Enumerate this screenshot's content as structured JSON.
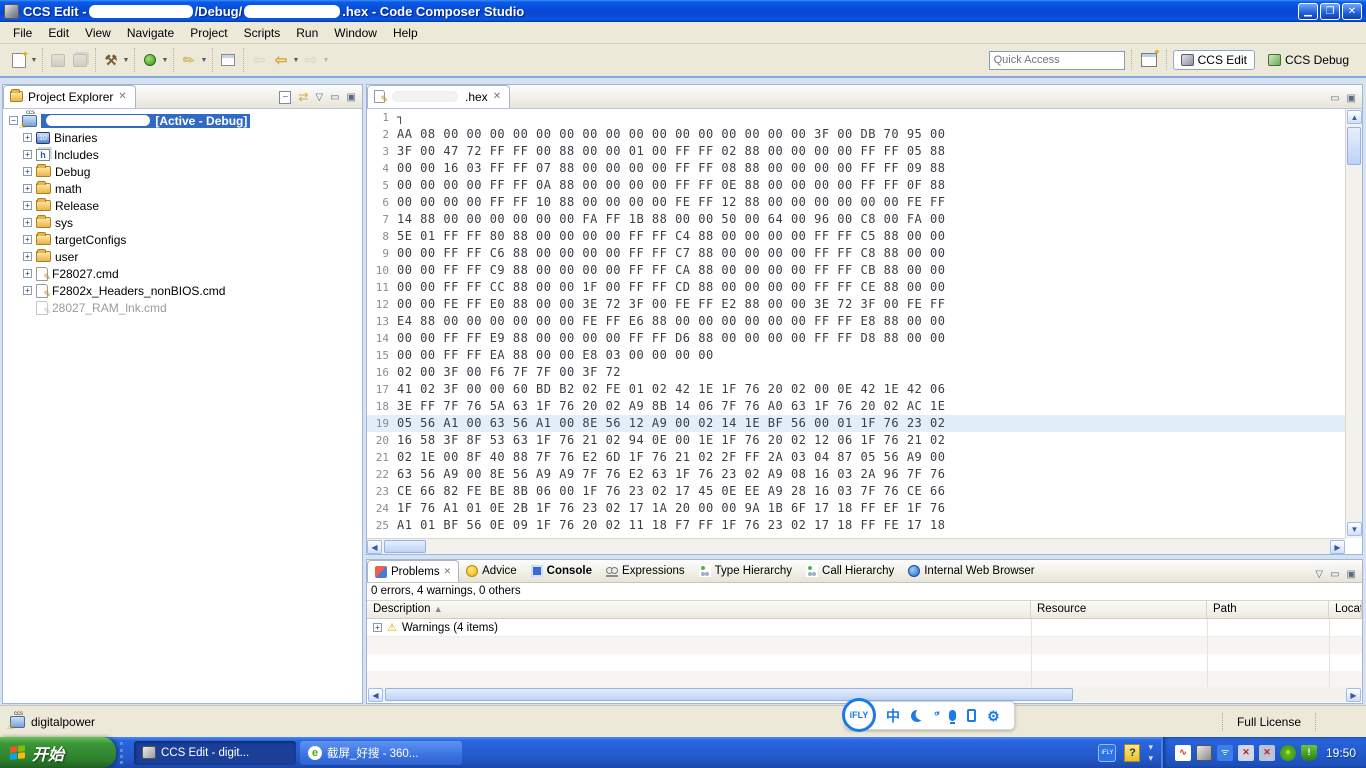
{
  "window": {
    "title_prefix": "CCS Edit - ",
    "title_mid": "/Debug/",
    "title_suffix": ".hex - Code Composer Studio"
  },
  "menu": {
    "items": [
      "File",
      "Edit",
      "View",
      "Navigate",
      "Project",
      "Scripts",
      "Run",
      "Window",
      "Help"
    ]
  },
  "toolbar": {
    "quick_access_placeholder": "Quick Access",
    "perspectives": {
      "edit": "CCS Edit",
      "debug": "CCS Debug"
    }
  },
  "project_explorer": {
    "title": "Project Explorer",
    "root_suffix": "[Active - Debug]",
    "items": [
      "Binaries",
      "Includes",
      "Debug",
      "math",
      "Release",
      "sys",
      "targetConfigs",
      "user",
      "F28027.cmd",
      "F2802x_Headers_nonBIOS.cmd",
      "28027_RAM_lnk.cmd"
    ]
  },
  "editor": {
    "tab_suffix": ".hex",
    "highlight_line": 19,
    "lines": [
      "┐",
      "AA 08 00 00 00 00 00 00 00 00 00 00 00 00 00 00 00 00 3F 00 DB 70 95 00",
      "3F 00 47 72 FF FF 00 88 00 00 01 00 FF FF 02 88 00 00 00 00 FF FF 05 88",
      "00 00 16 03 FF FF 07 88 00 00 00 00 FF FF 08 88 00 00 00 00 FF FF 09 88",
      "00 00 00 00 FF FF 0A 88 00 00 00 00 FF FF 0E 88 00 00 00 00 FF FF 0F 88",
      "00 00 00 00 FF FF 10 88 00 00 00 00 FE FF 12 88 00 00 00 00 00 00 FE FF",
      "14 88 00 00 00 00 00 00 FA FF 1B 88 00 00 50 00 64 00 96 00 C8 00 FA 00",
      "5E 01 FF FF 80 88 00 00 00 00 FF FF C4 88 00 00 00 00 FF FF C5 88 00 00",
      "00 00 FF FF C6 88 00 00 00 00 FF FF C7 88 00 00 00 00 FF FF C8 88 00 00",
      "00 00 FF FF C9 88 00 00 00 00 FF FF CA 88 00 00 00 00 FF FF CB 88 00 00",
      "00 00 FF FF CC 88 00 00 1F 00 FF FF CD 88 00 00 00 00 FF FF CE 88 00 00",
      "00 00 FE FF E0 88 00 00 3E 72 3F 00 FE FF E2 88 00 00 3E 72 3F 00 FE FF",
      "E4 88 00 00 00 00 00 00 FE FF E6 88 00 00 00 00 00 00 FF FF E8 88 00 00",
      "00 00 FF FF E9 88 00 00 00 00 FF FF D6 88 00 00 00 00 FF FF D8 88 00 00",
      "00 00 FF FF EA 88 00 00 E8 03 00 00 00 00",
      "02 00 3F 00 F6 7F 7F 00 3F 72",
      "41 02 3F 00 00 60 BD B2 02 FE 01 02 42 1E 1F 76 20 02 00 0E 42 1E 42 06",
      "3E FF 7F 76 5A 63 1F 76 20 02 A9 8B 14 06 7F 76 A0 63 1F 76 20 02 AC 1E",
      "05 56 A1 00 63 56 A1 00 8E 56 12 A9 00 02 14 1E BF 56 00 01 1F 76 23 02",
      "16 58 3F 8F 53 63 1F 76 21 02 94 0E 00 1E 1F 76 20 02 12 06 1F 76 21 02",
      "02 1E 00 8F 40 88 7F 76 E2 6D 1F 76 21 02 2F FF 2A 03 04 87 05 56 A9 00",
      "63 56 A9 00 8E 56 A9 A9 7F 76 E2 63 1F 76 23 02 A9 08 16 03 2A 96 7F 76",
      "CE 66 82 FE BE 8B 06 00 1F 76 23 02 17 45 0E EE A9 28 16 03 7F 76 CE 66",
      "1F 76 A1 01 0E 2B 1F 76 23 02 17 1A 20 00 00 9A 1B 6F 17 18 FF EF 1F 76",
      "A1 01 BF 56 0E 09 1F 76 20 02 11 18 F7 FF 1F 76 23 02 17 18 FF FE 17 18"
    ]
  },
  "problems": {
    "tabs": [
      "Problems",
      "Advice",
      "Console",
      "Expressions",
      "Type Hierarchy",
      "Call Hierarchy",
      "Internal Web Browser"
    ],
    "summary": "0 errors, 4 warnings, 0 others",
    "columns": [
      "Description",
      "Resource",
      "Path",
      "Location"
    ],
    "rows": [
      "Warnings (4 items)"
    ]
  },
  "status_bar": {
    "project": "digitalpower",
    "license": "Full License"
  },
  "ime": {
    "logo": "iFLY",
    "chinese_mode": "中"
  },
  "taskbar": {
    "start_label": "开始",
    "tasks": [
      "CCS Edit - digit...",
      "截屏_好搜 - 360..."
    ],
    "clock": "19:50"
  }
}
